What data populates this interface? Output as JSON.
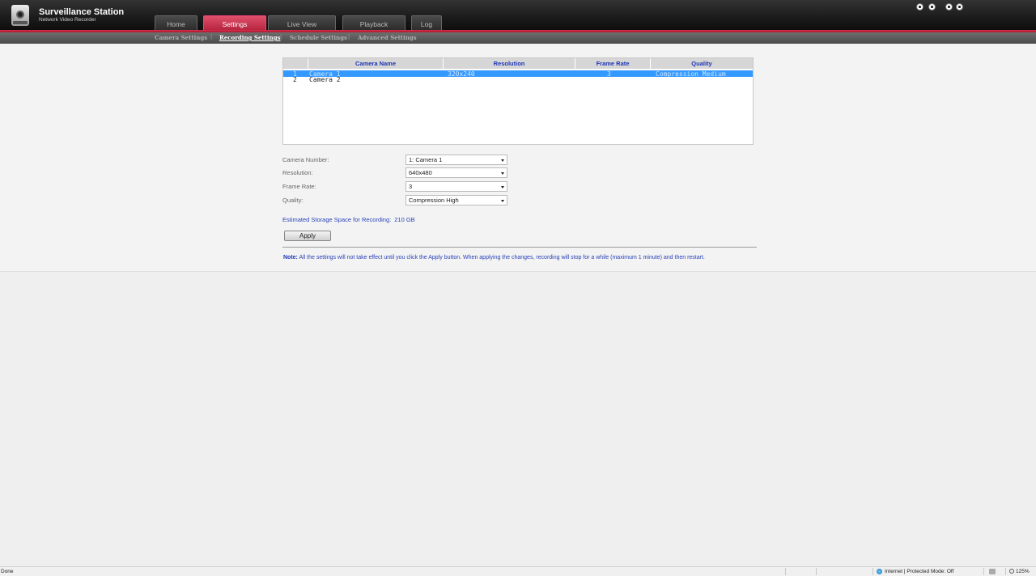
{
  "app": {
    "title": "Surveillance Station",
    "subtitle": "Network Video Recorder"
  },
  "tabs": [
    {
      "label": "Home",
      "active": false
    },
    {
      "label": "Settings",
      "active": true
    },
    {
      "label": "Live View",
      "active": false
    },
    {
      "label": "Playback",
      "active": false
    },
    {
      "label": "Log",
      "active": false
    }
  ],
  "subnav": [
    {
      "label": "Camera Settings",
      "active": false
    },
    {
      "label": "Recording Settings",
      "active": true
    },
    {
      "label": "Schedule Settings",
      "active": false
    },
    {
      "label": "Advanced Settings",
      "active": false
    }
  ],
  "subnav_separator": "|",
  "header_icons": [
    "home-icon",
    "logout-icon",
    "help-icon",
    "forward-icon"
  ],
  "table": {
    "columns": [
      "",
      "Camera Name",
      "Resolution",
      "Frame Rate",
      "Quality"
    ],
    "rows": [
      {
        "num": "1",
        "name": "Camera 1",
        "resolution": "320x240",
        "frame_rate": "3",
        "quality": "Compression Medium",
        "selected": true
      },
      {
        "num": "2",
        "name": "Camera 2",
        "resolution": "",
        "frame_rate": "",
        "quality": "",
        "selected": false
      }
    ]
  },
  "form": {
    "camera_number": {
      "label": "Camera Number:",
      "value": "1: Camera 1"
    },
    "resolution": {
      "label": "Resolution:",
      "value": "640x480"
    },
    "frame_rate": {
      "label": "Frame Rate:",
      "value": "3"
    },
    "quality": {
      "label": "Quality:",
      "value": "Compression High"
    }
  },
  "storage": {
    "label": "Estimated Storage Space for Recording:",
    "value": "210 GB"
  },
  "apply_label": "Apply",
  "note": {
    "prefix": "Note:",
    "text": "All the settings will not take effect until you click the Apply button. When applying the changes, recording will stop for a while (maximum 1 minute) and then restart."
  },
  "statusbar": {
    "status": "Done",
    "zone": "Internet | Protected Mode: Off",
    "zoom": "125%"
  },
  "colors": {
    "accent_red": "#c8223f",
    "link_blue": "#1f35b5",
    "selection": "#3399ff"
  }
}
